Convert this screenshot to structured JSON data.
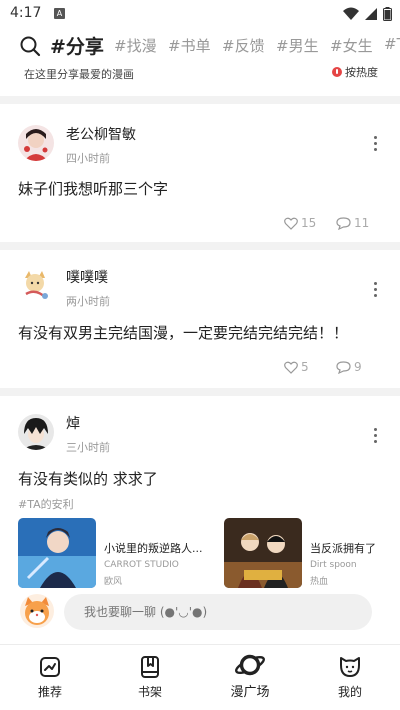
{
  "status_bar": {
    "time": "4:17",
    "notification_icon": "A"
  },
  "header": {
    "tabs": [
      {
        "label": "#分享",
        "active": true
      },
      {
        "label": "#找漫"
      },
      {
        "label": "#书单"
      },
      {
        "label": "#反馈"
      },
      {
        "label": "#男生"
      },
      {
        "label": "#女生"
      },
      {
        "label": "#T"
      }
    ],
    "subtitle": "在这里分享最爱的漫画",
    "sort_label": "按热度"
  },
  "posts": [
    {
      "author": "老公柳智敏",
      "time": "四小时前",
      "content": "妹子们我想听那三个字",
      "likes": "15",
      "comments": "11"
    },
    {
      "author": "噗噗噗",
      "time": "两小时前",
      "content": "有没有双男主完结国漫，一定要完结完结完结！！",
      "likes": "5",
      "comments": "9"
    },
    {
      "author": "焯",
      "time": "三小时前",
      "content": "有没有类似的 求求了",
      "tag": "#TA的安利",
      "recommendations": [
        {
          "title": "小说里的叛逆路人...",
          "author": "CARROT STUDIO",
          "genre": "欧风"
        },
        {
          "title": "当反派拥有了",
          "author": "Dirt spoon",
          "genre": "热血"
        }
      ]
    }
  ],
  "comment_bar": {
    "placeholder": "我也要聊一聊 (●'◡'●)"
  },
  "bottom_nav": [
    {
      "label": "推荐",
      "icon": "recommend-icon"
    },
    {
      "label": "书架",
      "icon": "bookshelf-icon"
    },
    {
      "label": "漫广场",
      "icon": "planet-icon",
      "active": true
    },
    {
      "label": "我的",
      "icon": "cat-face-icon"
    }
  ]
}
